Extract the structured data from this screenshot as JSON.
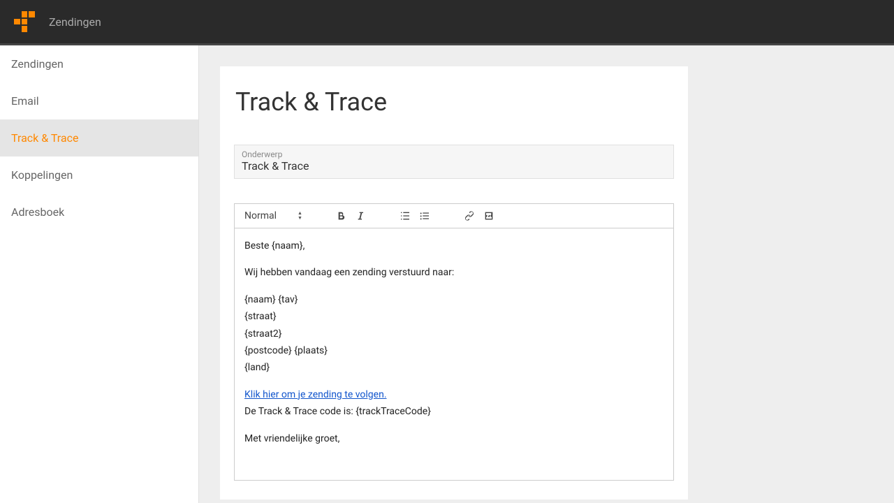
{
  "header": {
    "title": "Zendingen"
  },
  "sidebar": {
    "items": [
      {
        "label": "Zendingen"
      },
      {
        "label": "Email"
      },
      {
        "label": "Track & Trace"
      },
      {
        "label": "Koppelingen"
      },
      {
        "label": "Adresboek"
      }
    ]
  },
  "page": {
    "title": "Track & Trace"
  },
  "subject": {
    "label": "Onderwerp",
    "value": "Track & Trace"
  },
  "toolbar": {
    "format": "Normal"
  },
  "body": {
    "line1": "Beste {naam},",
    "line2": "Wij hebben vandaag een zending verstuurd naar:",
    "addr1": "{naam} {tav}",
    "addr2": "{straat}",
    "addr3": "{straat2}",
    "addr4": "{postcode} {plaats}",
    "addr5": "{land}",
    "link": "Klik hier om je zending te volgen.",
    "code": "De Track & Trace code is: {trackTraceCode}",
    "signoff": "Met vriendelijke groet,"
  }
}
